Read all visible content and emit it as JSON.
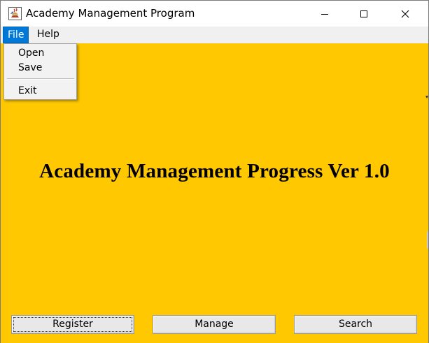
{
  "window": {
    "title": "Academy Management Program",
    "icon": "java-cup-icon"
  },
  "titlebar_controls": {
    "minimize_icon": "minimize-icon",
    "maximize_icon": "maximize-icon",
    "close_icon": "close-icon"
  },
  "menubar": {
    "items": [
      {
        "label": "File",
        "selected": true
      },
      {
        "label": "Help",
        "selected": false
      }
    ]
  },
  "file_menu": {
    "items": [
      {
        "label": "Open"
      },
      {
        "label": "Save"
      },
      {
        "label": "Exit"
      }
    ]
  },
  "main": {
    "heading": "Academy Management Progress Ver 1.0",
    "background_color": "#ffc800"
  },
  "buttons": {
    "register": "Register",
    "manage": "Manage",
    "search": "Search"
  },
  "colors": {
    "menu_highlight": "#0078d7",
    "panel": "#ffc800",
    "button_face": "#e8e8e8"
  }
}
